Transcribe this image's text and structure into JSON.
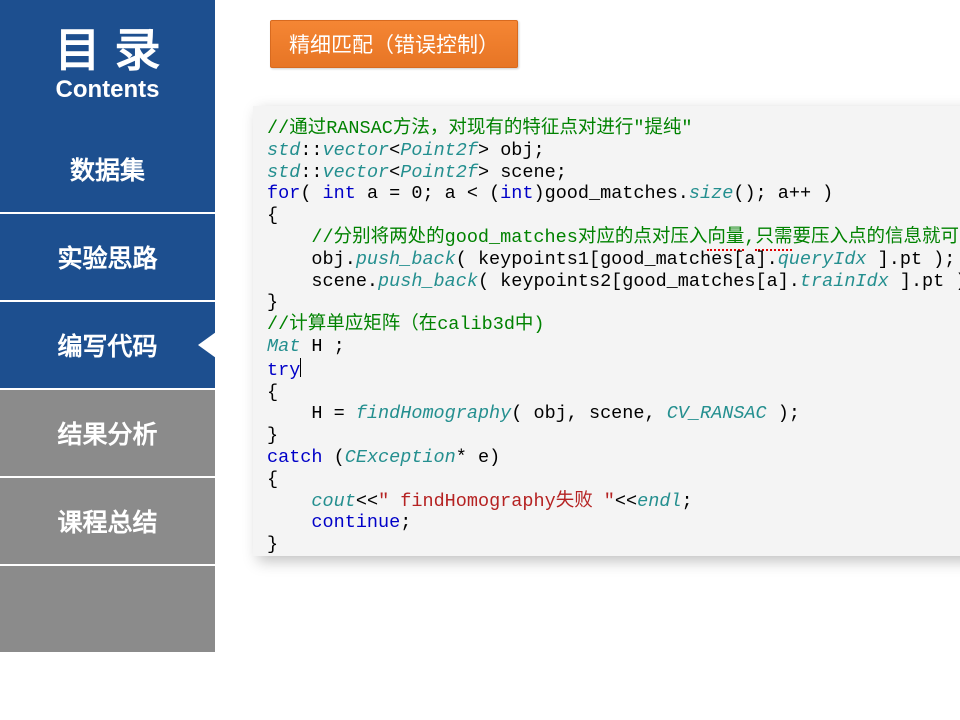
{
  "sidebar": {
    "title_cn": "目录",
    "title_en": "Contents",
    "items": [
      {
        "label": "数据集",
        "kind": "blue",
        "active": false
      },
      {
        "label": "实验思路",
        "kind": "blue",
        "active": false
      },
      {
        "label": "编写代码",
        "kind": "blue",
        "active": true
      },
      {
        "label": "结果分析",
        "kind": "gray",
        "active": false
      },
      {
        "label": "课程总结",
        "kind": "gray",
        "active": false
      },
      {
        "label": "",
        "kind": "blank",
        "active": false
      }
    ]
  },
  "tag": {
    "label": "精细匹配（错误控制）"
  },
  "code": {
    "line1_comment": "//通过RANSAC方法，对现有的特征点对进行\"提纯\"",
    "line2": {
      "std": "std",
      "vector": "vector",
      "point2f": "Point2f",
      "tail": " obj;"
    },
    "line3": {
      "std": "std",
      "vector": "vector",
      "point2f": "Point2f",
      "tail": " scene;"
    },
    "line4": {
      "for": "for",
      "int_kw": "int",
      "a_eq": " a = 0; a < (",
      "int_kw2": "int",
      "mid": ")good_matches.",
      "size": "size",
      "tail": "(); a++ )"
    },
    "line5": "{",
    "line6": {
      "pre": "    //分别将两处的good_matches对应的点对压入",
      "wave1": "向量",
      "mid": ",",
      "wave2": "只需",
      "tail": "要压入点的信息就可以"
    },
    "line7": {
      "pre": "    obj.",
      "push": "push_back",
      "mid": "( keypoints1[good_matches[a].",
      "field": "queryIdx",
      "tail": " ].pt );"
    },
    "line8": {
      "pre": "    scene.",
      "push": "push_back",
      "mid": "( keypoints2[good_matches[a].",
      "field": "trainIdx",
      "tail": " ].pt );"
    },
    "line9": "}",
    "line10_comment": "//计算单应矩阵（在calib3d中)",
    "line11": {
      "mat": "Mat",
      "tail": " H ;"
    },
    "line12": "try",
    "line13": "{",
    "line14": {
      "pre": "    H = ",
      "fn": "findHomography",
      "mid": "( obj, scene, ",
      "const": "CV_RANSAC",
      "tail": " );"
    },
    "line15": "}",
    "line16": {
      "catch": "catch",
      "pre": " (",
      "type": "CException",
      "tail": "* e)"
    },
    "line17": "{",
    "line18": {
      "pre": "    ",
      "cout": "cout",
      "lt": "<<",
      "str": "\" findHomography失败 \"",
      "lt2": "<<",
      "endl": "endl",
      "tail": ";"
    },
    "line19": {
      "pre": "    ",
      "cont": "continue",
      "tail": ";"
    },
    "line20": "}"
  }
}
